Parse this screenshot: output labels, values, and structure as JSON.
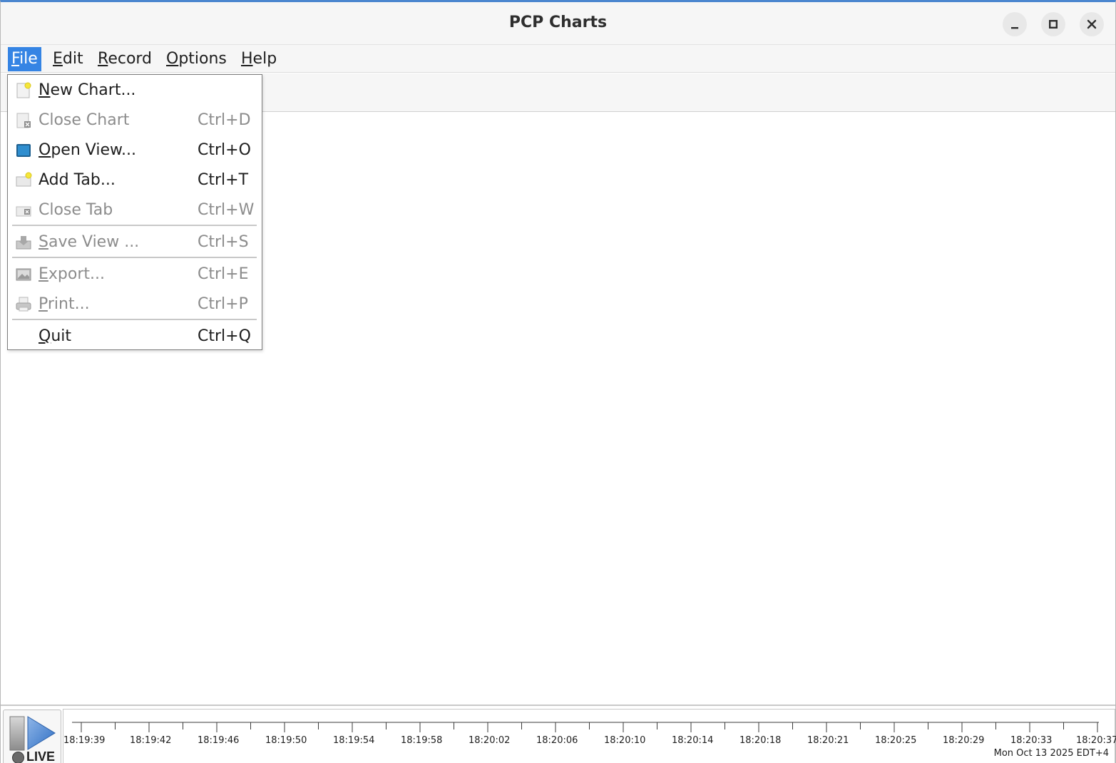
{
  "window": {
    "title": "PCP Charts"
  },
  "menubar": [
    {
      "label": "File",
      "mnemonic": "F",
      "rest": "ile",
      "active": true
    },
    {
      "label": "Edit",
      "mnemonic": "E",
      "rest": "dit",
      "active": false
    },
    {
      "label": "Record",
      "mnemonic": "R",
      "rest": "ecord",
      "active": false
    },
    {
      "label": "Options",
      "mnemonic": "O",
      "rest": "ptions",
      "active": false
    },
    {
      "label": "Help",
      "mnemonic": "H",
      "rest": "elp",
      "active": false
    }
  ],
  "file_menu": {
    "items": [
      {
        "mnemonic": "N",
        "rest": "ew Chart...",
        "shortcut": "",
        "enabled": true,
        "icon": "new-chart-icon"
      },
      {
        "mnemonic": "",
        "rest": "Close Chart",
        "shortcut": "Ctrl+D",
        "enabled": false,
        "icon": "close-chart-icon"
      },
      {
        "mnemonic": "O",
        "rest": "pen View...",
        "shortcut": "Ctrl+O",
        "enabled": true,
        "icon": "open-view-icon"
      },
      {
        "mnemonic": "",
        "rest": "Add Tab...",
        "shortcut": "Ctrl+T",
        "enabled": true,
        "icon": "add-tab-icon"
      },
      {
        "mnemonic": "",
        "rest": "Close Tab",
        "shortcut": "Ctrl+W",
        "enabled": false,
        "icon": "close-tab-icon"
      },
      {
        "mnemonic": "S",
        "rest": "ave View ...",
        "shortcut": "Ctrl+S",
        "enabled": false,
        "icon": "save-view-icon"
      },
      {
        "mnemonic": "E",
        "rest": "xport...",
        "shortcut": "Ctrl+E",
        "enabled": false,
        "icon": "export-icon"
      },
      {
        "mnemonic": "P",
        "rest": "rint...",
        "shortcut": "Ctrl+P",
        "enabled": false,
        "icon": "print-icon"
      },
      {
        "mnemonic": "Q",
        "rest": "uit",
        "shortcut": "Ctrl+Q",
        "enabled": true,
        "icon": ""
      }
    ]
  },
  "live_button": {
    "label": "LIVE"
  },
  "time_axis": {
    "ticks": [
      "18:19:39",
      "18:19:42",
      "18:19:46",
      "18:19:50",
      "18:19:54",
      "18:19:58",
      "18:20:02",
      "18:20:06",
      "18:20:10",
      "18:20:14",
      "18:20:18",
      "18:20:21",
      "18:20:25",
      "18:20:29",
      "18:20:33",
      "18:20:37"
    ],
    "date": "Mon Oct 13 2025 EDT+4"
  },
  "colors": {
    "accent": "#3584e4",
    "titlebar_border": "#4a86cf",
    "disabled_text": "#8c8c8c"
  }
}
